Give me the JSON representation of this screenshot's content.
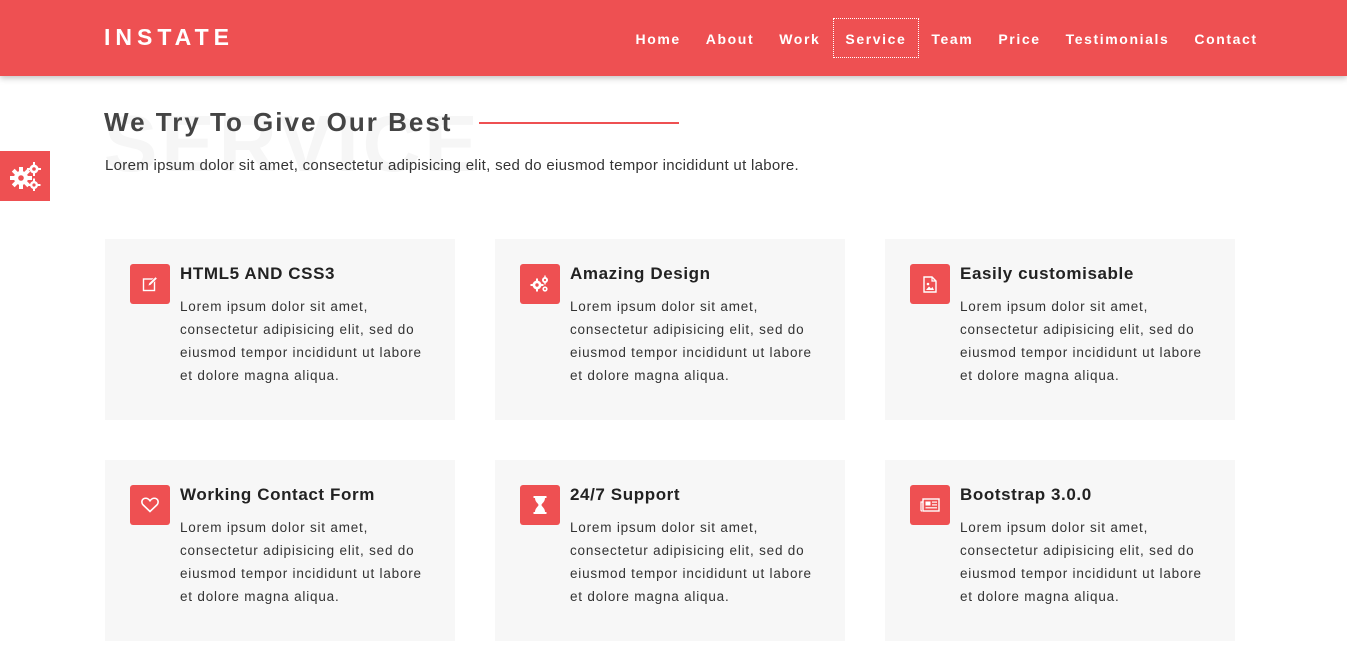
{
  "brand": "INSTATE",
  "nav": {
    "items": [
      "Home",
      "About",
      "Work",
      "Service",
      "Team",
      "Price",
      "Testimonials",
      "Contact"
    ],
    "active": "Service"
  },
  "section": {
    "watermark": "SERVICE",
    "title": "We Try To Give Our Best",
    "description": "Lorem ipsum dolor sit amet, consectetur adipisicing elit, sed do eiusmod tempor incididunt ut labore."
  },
  "settings_tab": {
    "icon": "gears-icon"
  },
  "features": [
    {
      "icon": "edit-icon",
      "title": "HTML5 AND CSS3",
      "text": "Lorem ipsum dolor sit amet, consectetur adipisicing elit, sed do eiusmod tempor incididunt ut labore et dolore magna aliqua."
    },
    {
      "icon": "gears-icon",
      "title": "Amazing Design",
      "text": "Lorem ipsum dolor sit amet, consectetur adipisicing elit, sed do eiusmod tempor incididunt ut labore et dolore magna aliqua."
    },
    {
      "icon": "image-file-icon",
      "title": "Easily customisable",
      "text": "Lorem ipsum dolor sit amet, consectetur adipisicing elit, sed do eiusmod tempor incididunt ut labore et dolore magna aliqua."
    },
    {
      "icon": "heart-icon",
      "title": "Working Contact Form",
      "text": "Lorem ipsum dolor sit amet, consectetur adipisicing elit, sed do eiusmod tempor incididunt ut labore et dolore magna aliqua."
    },
    {
      "icon": "hourglass-icon",
      "title": "24/7 Support",
      "text": "Lorem ipsum dolor sit amet, consectetur adipisicing elit, sed do eiusmod tempor incididunt ut labore et dolore magna aliqua."
    },
    {
      "icon": "newspaper-icon",
      "title": "Bootstrap 3.0.0",
      "text": "Lorem ipsum dolor sit amet, consectetur adipisicing elit, sed do eiusmod tempor incididunt ut labore et dolore magna aliqua."
    }
  ],
  "colors": {
    "accent": "#ee5052",
    "card_bg": "#f7f7f7",
    "heading": "#444444"
  }
}
